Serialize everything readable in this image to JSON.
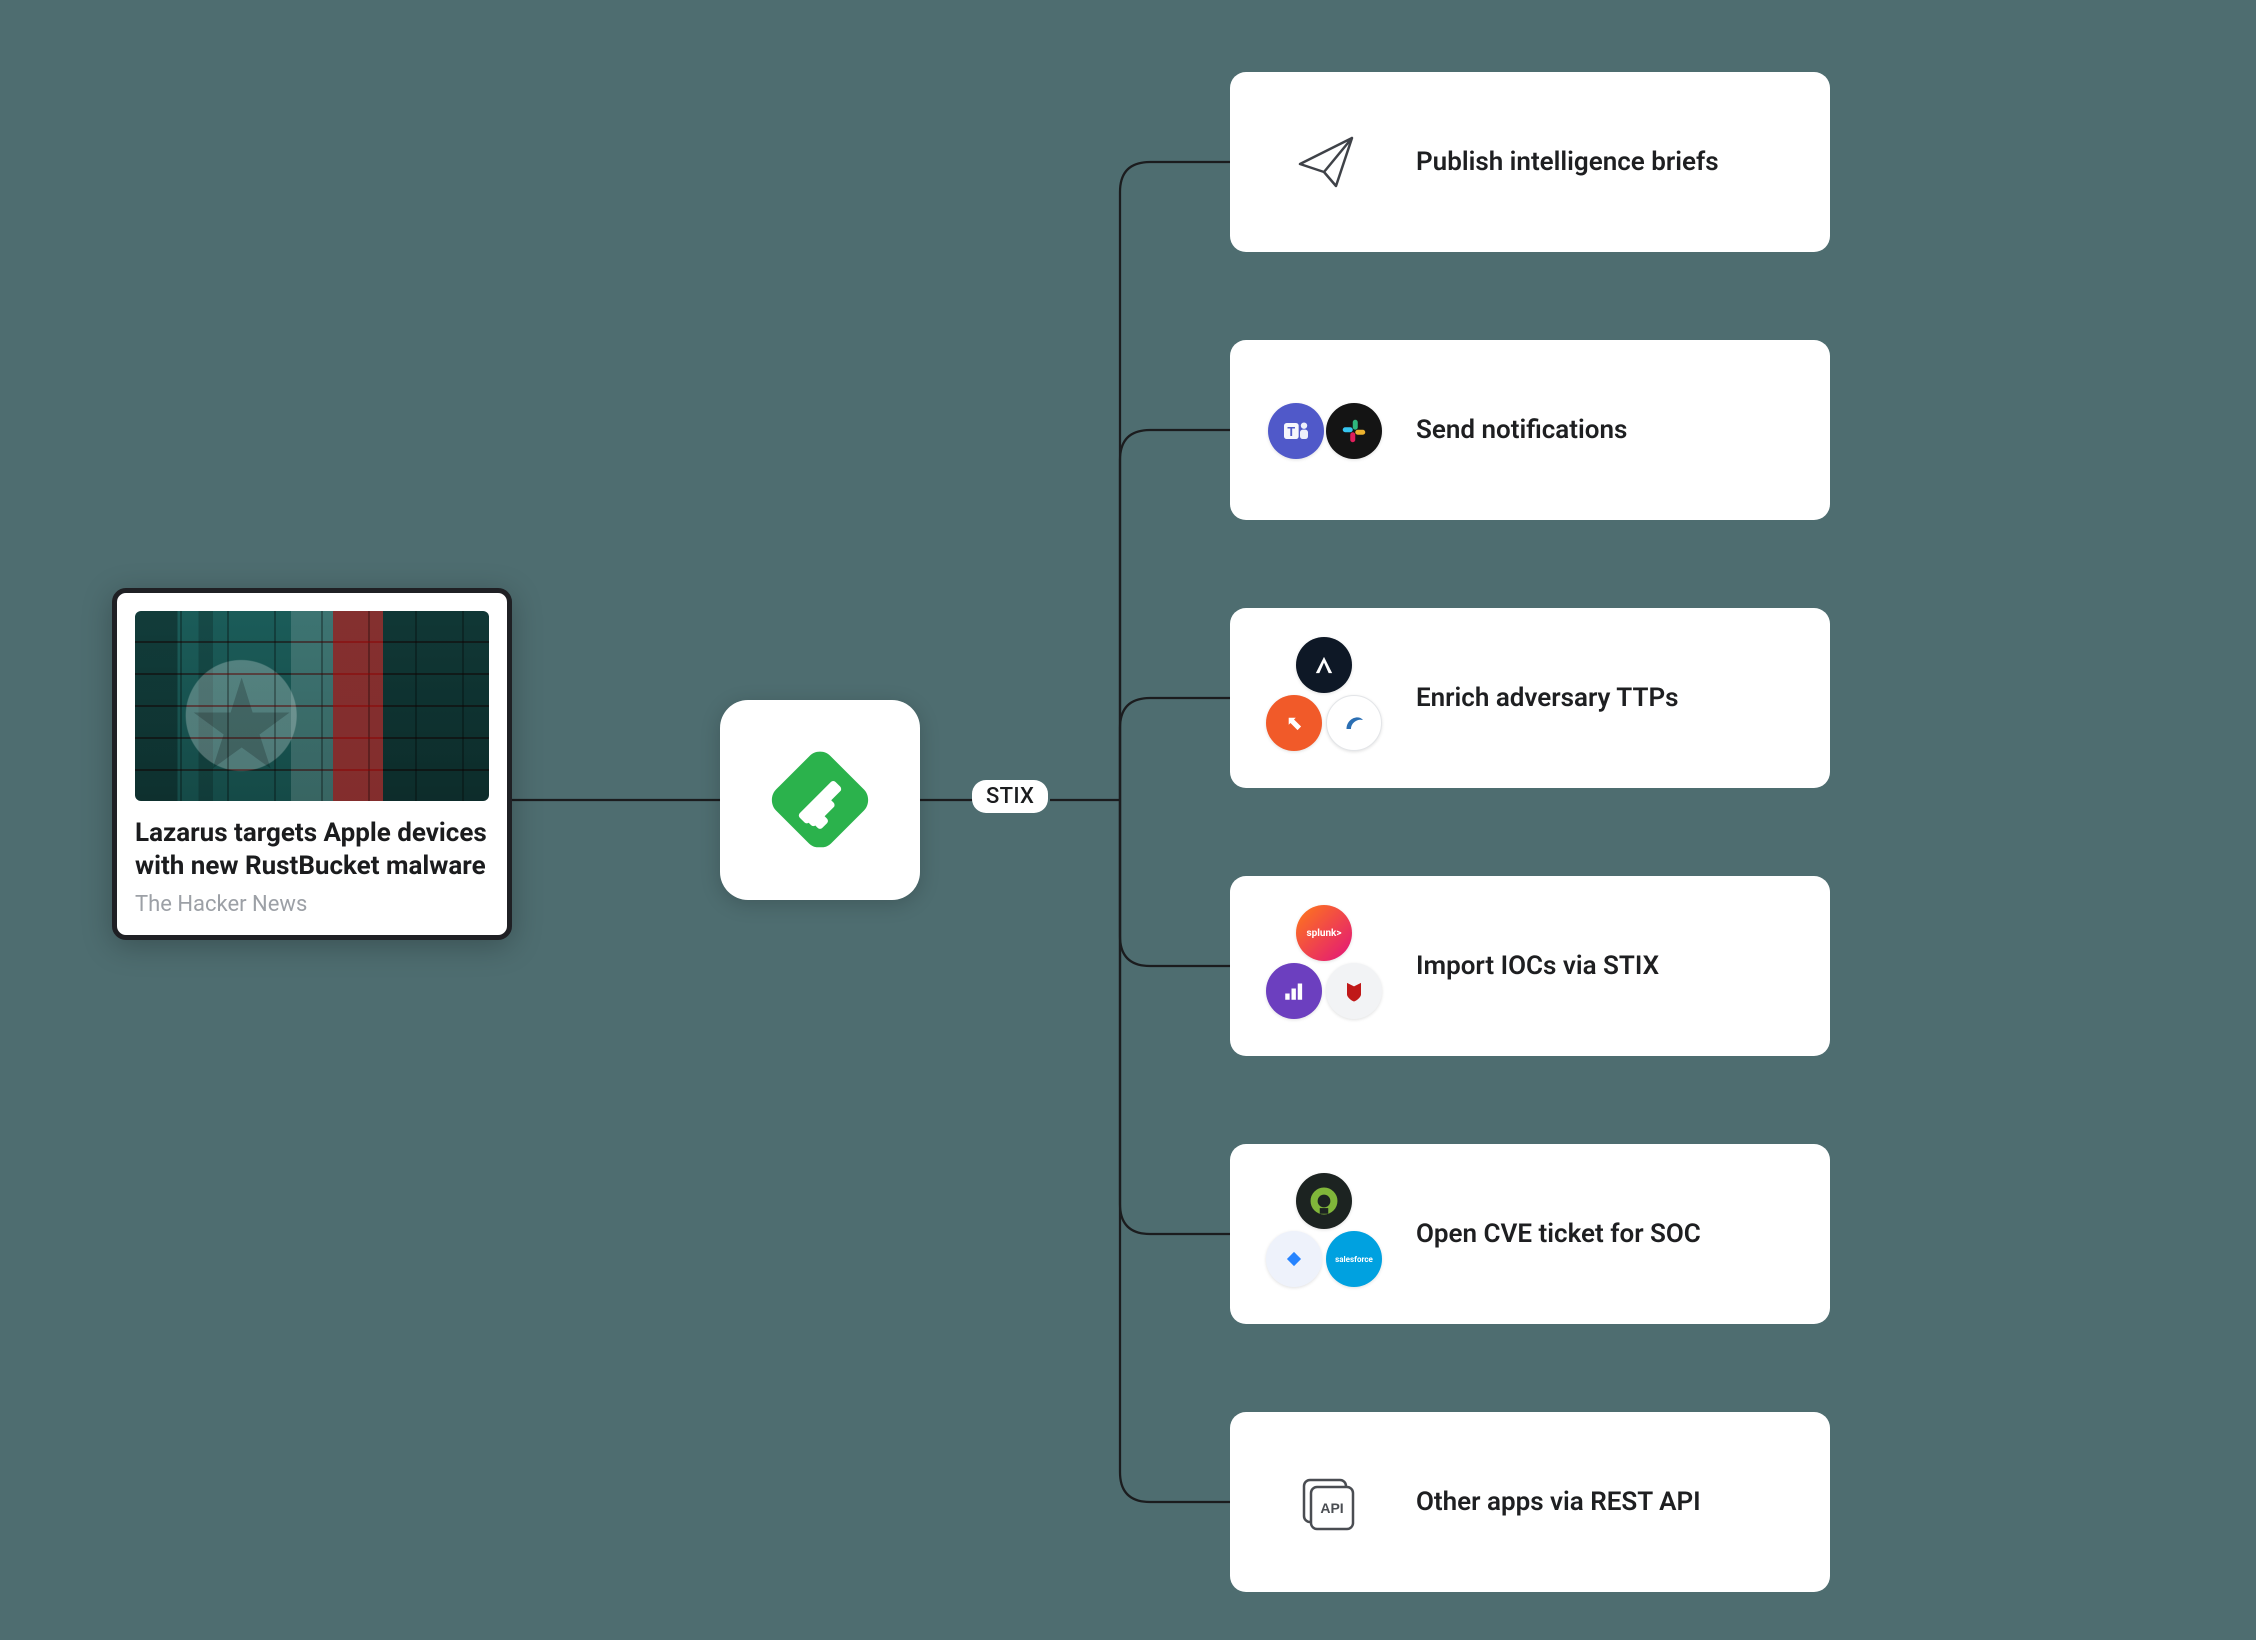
{
  "article": {
    "title": "Lazarus targets Apple devices with new RustBucket malware",
    "source": "The Hacker News"
  },
  "center": {
    "icon": "feedly-icon"
  },
  "badge": {
    "label": "STIX"
  },
  "integrations": [
    {
      "label": "Publish intelligence briefs",
      "icons": [
        "paper-plane-icon"
      ]
    },
    {
      "label": "Send notifications",
      "icons": [
        "microsoft-teams-icon",
        "slack-icon"
      ]
    },
    {
      "label": "Enrich adversary TTPs",
      "icons": [
        "attack-navigator-icon",
        "mitre-icon",
        "recorded-future-icon"
      ]
    },
    {
      "label": "Import IOCs via STIX",
      "icons": [
        "splunk-icon",
        "elastic-icon",
        "mcafee-icon"
      ]
    },
    {
      "label": "Open CVE ticket for SOC",
      "icons": [
        "servicenow-icon",
        "jira-icon",
        "salesforce-icon"
      ]
    },
    {
      "label": "Other apps via REST API",
      "icons": [
        "api-icon"
      ]
    }
  ],
  "colors": {
    "bg": "#4e6d70",
    "card": "#ffffff",
    "feedly": "#2bb24c"
  }
}
